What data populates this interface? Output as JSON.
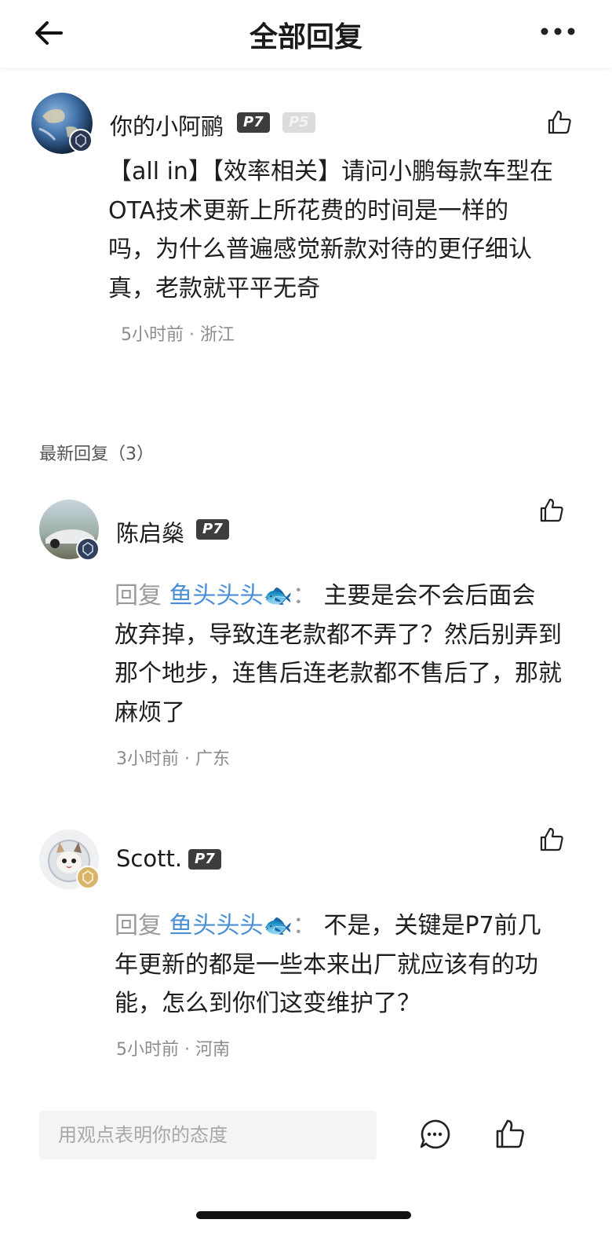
{
  "header": {
    "title": "全部回复",
    "back_icon": "arrow-left-icon",
    "more_icon": "more-horizontal-icon"
  },
  "main_post": {
    "username": "你的小阿鹂",
    "badges": [
      "P7",
      "P5"
    ],
    "content": "【all in】【效率相关】请问小鹏每款车型在OTA技术更新上所花费的时间是一样的吗，为什么普遍感觉新款对待的更仔细认真，老款就平平无奇",
    "lines": [
      "【all in】【效率相关】请问小鹏每款车型在",
      "OTA技术更新上所花费的时间是一样的",
      "吗，为什么普遍感觉新款对待的更仔细认",
      "真，老款就平平无奇"
    ],
    "meta": "5小时前 · 浙江"
  },
  "replies_section": {
    "title": "最新回复（3）"
  },
  "replies": [
    {
      "username": "陈启燊",
      "badge": "P7",
      "reply_prefix": "回复",
      "reply_to": "鱼头头头🐟",
      "separator": "：",
      "lines": [
        "主要是会不会后面会",
        "放弃掉，导致连老款都不弄了？然后别弄到",
        "那个地步，连售后连老款都不售后了，那就",
        "麻烦了"
      ],
      "meta": "3小时前 · 广东"
    },
    {
      "username": "Scott.",
      "badge": "P7",
      "reply_prefix": "回复",
      "reply_to": "鱼头头头🐟",
      "separator": "：",
      "lines": [
        "不是，关键是P7前几",
        "年更新的都是一些本来出厂就应该有的功",
        "能，怎么到你们这变维护了？"
      ],
      "meta": "5小时前 · 河南"
    }
  ],
  "bottom_bar": {
    "input_placeholder": "用观点表明你的态度",
    "comment_icon": "comment-bubble-icon",
    "like_icon": "thumbs-up-icon"
  },
  "colors": {
    "reply_to": "#4a8fd6",
    "badge_dark": "#3d3d3d",
    "meta": "#8c8c8c"
  }
}
